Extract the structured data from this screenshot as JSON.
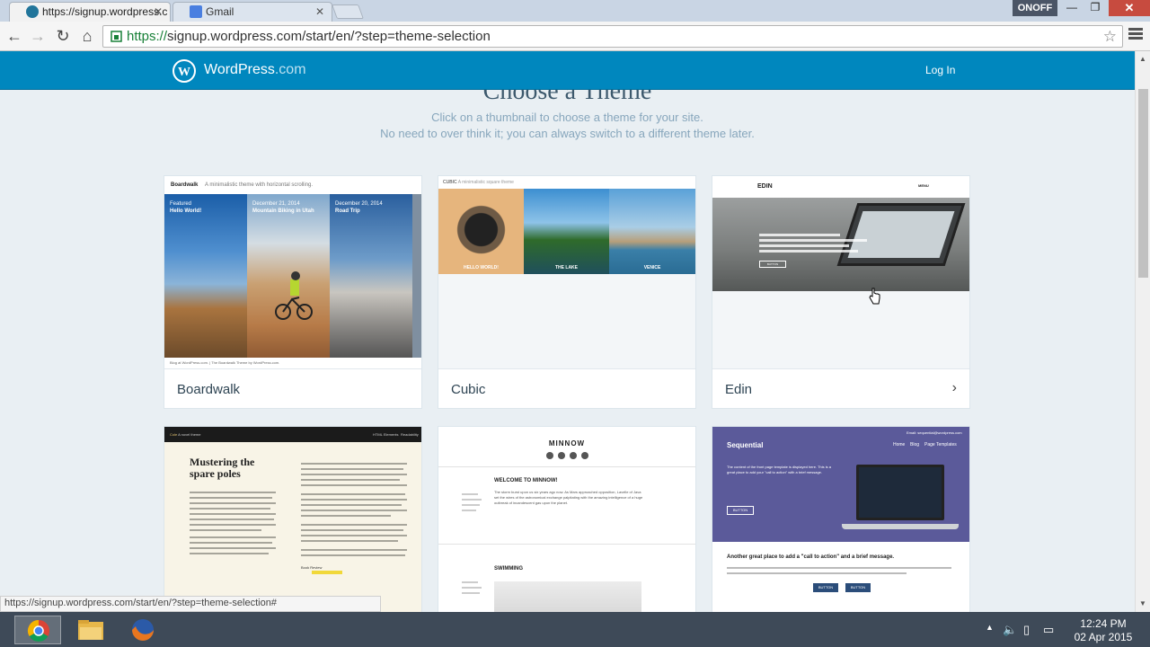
{
  "browser": {
    "tabs": [
      {
        "label": "https://signup.wordpress.c",
        "favicon": "wordpress-icon"
      },
      {
        "label": "Gmail",
        "favicon": "google-icon"
      }
    ],
    "onoff_label": "ONOFF",
    "window_buttons": {
      "minimize": "—",
      "maximize": "❐",
      "close": "✕"
    },
    "url_scheme": "https://",
    "url_rest": "signup.wordpress.com/start/en/?step=theme-selection",
    "status_url": "https://signup.wordpress.com/start/en/?step=theme-selection#"
  },
  "header": {
    "brand": "WordPress",
    "brand_suffix": ".com",
    "login_label": "Log In"
  },
  "page": {
    "title": "Choose a Theme",
    "subtitle_line1": "Click on a thumbnail to choose a theme for your site.",
    "subtitle_line2": "No need to over think it; you can always switch to a different theme later."
  },
  "themes": [
    {
      "name": "Boardwalk",
      "thumb_header": "Boardwalk",
      "thumb_tagline": "A minimalistic theme with horizontal scrolling.",
      "panels": [
        {
          "date": "Featured",
          "title": "Hello World!"
        },
        {
          "date": "December 21, 2014",
          "title": "Mountain Biking in Utah"
        },
        {
          "date": "December 20, 2014",
          "title": "Road Trip"
        }
      ],
      "footer_text": "Blog at WordPress.com. | The Boardwalk Theme by WordPress.com."
    },
    {
      "name": "Cubic",
      "thumb_header": "CUBIC",
      "thumb_tagline": "A minimalistic square theme",
      "captions": [
        "HELLO WORLD!",
        "THE LAKE",
        "VENICE"
      ]
    },
    {
      "name": "Edin",
      "thumb_header": "EDIN",
      "nav_label": "MENU",
      "button_label": "BUTTON"
    },
    {
      "name": "Cole",
      "thumb_header": "Cole",
      "thumb_tagline": "A novel theme",
      "nav_items": [
        "HTML Elements",
        "Readability"
      ],
      "post_title": "Mustering the spare poles",
      "byline": "Book Review"
    },
    {
      "name": "Minnow",
      "thumb_header": "MINNOW",
      "post1": "WELCOME TO MINNOW!",
      "post2": "SWIMMING",
      "excerpt": "The storm burst upon us six years ago now. As Mars approached opposition, Lavelle of Java set the wires of the astronomical exchange palpitating with the amazing intelligence of a huge outbreak of incandescent gas upon the planet."
    },
    {
      "name": "Sequential",
      "thumb_header": "Sequential",
      "nav_items": [
        "Home",
        "Blog",
        "Page Templates"
      ],
      "email": "Email: sequential@wordpress.com",
      "hero_text": "The content of the front page template is displayed here. This is a great place to add your \"call to action\" with a brief message.",
      "button_label": "BUTTON",
      "bottom_title": "Another great place to add a \"call to action\" and a brief message."
    }
  ],
  "taskbar": {
    "time": "12:24 PM",
    "date": "02 Apr 2015"
  },
  "colors": {
    "wp_blue": "#0087be",
    "page_bg": "#e9eff3",
    "taskbar": "#3e4a58"
  }
}
